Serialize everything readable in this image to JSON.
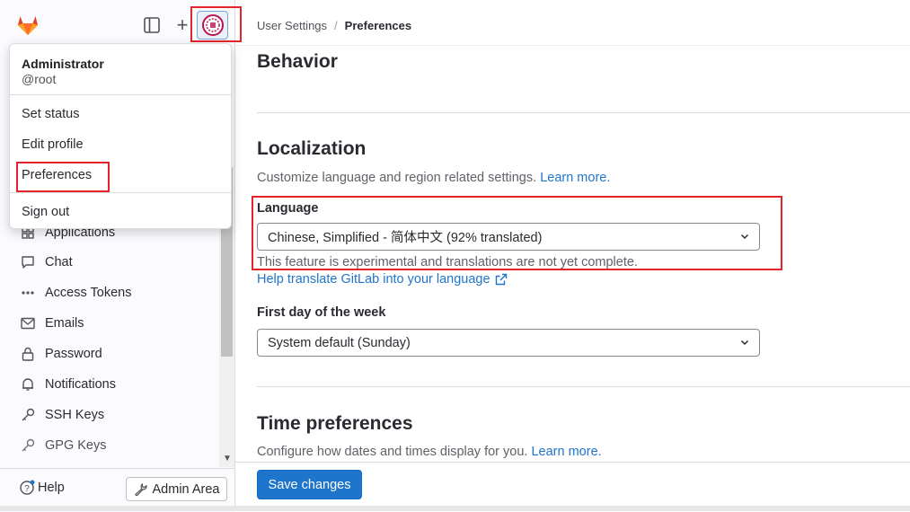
{
  "breadcrumb": {
    "parent": "User Settings",
    "separator": "/",
    "current": "Preferences"
  },
  "user_menu": {
    "name": "Administrator",
    "username": "@root",
    "items": [
      "Set status",
      "Edit profile",
      "Preferences",
      "Sign out"
    ]
  },
  "sidebar": {
    "items": [
      {
        "label": "Applications",
        "icon": "applications-icon"
      },
      {
        "label": "Chat",
        "icon": "chat-icon"
      },
      {
        "label": "Access Tokens",
        "icon": "token-icon"
      },
      {
        "label": "Emails",
        "icon": "mail-icon"
      },
      {
        "label": "Password",
        "icon": "lock-icon"
      },
      {
        "label": "Notifications",
        "icon": "bell-icon"
      },
      {
        "label": "SSH Keys",
        "icon": "key-icon"
      },
      {
        "label": "GPG Keys",
        "icon": "key-icon"
      }
    ],
    "help_label": "Help",
    "admin_label": "Admin Area"
  },
  "behavior": {
    "title": "Behavior"
  },
  "localization": {
    "title": "Localization",
    "description": "Customize language and region related settings.",
    "learn_more": "Learn more.",
    "language_label": "Language",
    "language_value": "Chinese, Simplified - 简体中文 (92% translated)",
    "language_help": "This feature is experimental and translations are not yet complete.",
    "translate_link": "Help translate GitLab into your language",
    "first_day_label": "First day of the week",
    "first_day_value": "System default (Sunday)"
  },
  "time_preferences": {
    "title": "Time preferences",
    "description": "Configure how dates and times display for you.",
    "learn_more": "Learn more."
  },
  "save_label": "Save changes",
  "colors": {
    "accent": "#1f75cb",
    "highlight": "#e4232b",
    "logo": "#e24329"
  }
}
